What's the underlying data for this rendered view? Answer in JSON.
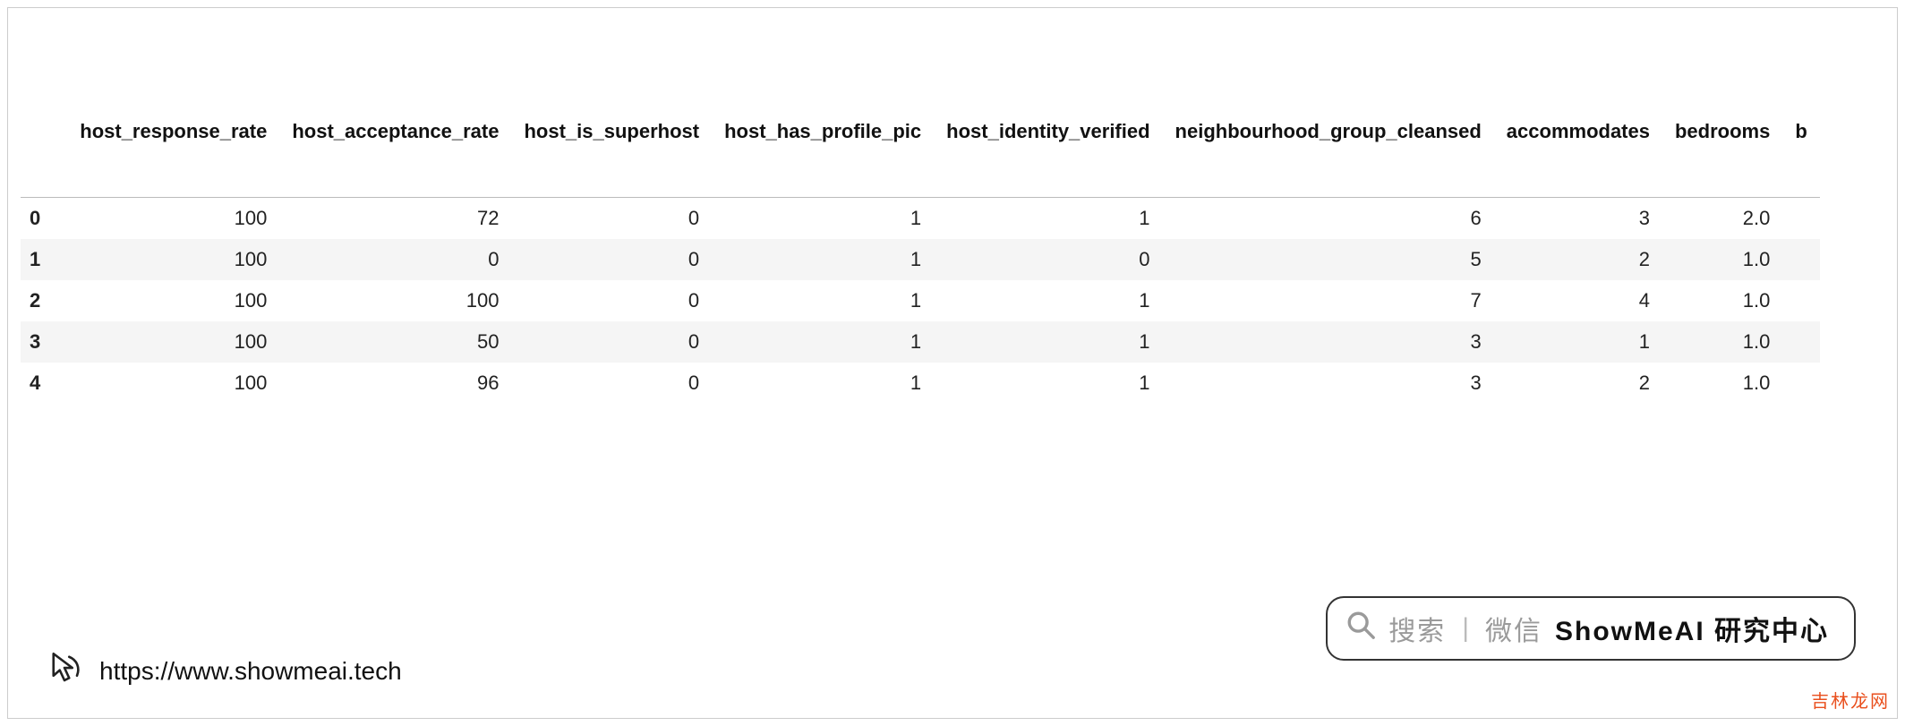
{
  "table": {
    "columns": [
      "host_response_rate",
      "host_acceptance_rate",
      "host_is_superhost",
      "host_has_profile_pic",
      "host_identity_verified",
      "neighbourhood_group_cleansed",
      "accommodates",
      "bedrooms",
      "b"
    ],
    "index": [
      "0",
      "1",
      "2",
      "3",
      "4"
    ],
    "rows": [
      [
        "100",
        "72",
        "0",
        "1",
        "1",
        "6",
        "3",
        "2.0",
        ""
      ],
      [
        "100",
        "0",
        "0",
        "1",
        "0",
        "5",
        "2",
        "1.0",
        ""
      ],
      [
        "100",
        "100",
        "0",
        "1",
        "1",
        "7",
        "4",
        "1.0",
        ""
      ],
      [
        "100",
        "50",
        "0",
        "1",
        "1",
        "3",
        "1",
        "1.0",
        ""
      ],
      [
        "100",
        "96",
        "0",
        "1",
        "1",
        "3",
        "2",
        "1.0",
        ""
      ]
    ]
  },
  "footer": {
    "url": "https://www.showmeai.tech"
  },
  "search_pill": {
    "grey": "搜索",
    "grey2": "微信",
    "bold": "ShowMeAI 研究中心"
  },
  "corner": "吉林龙网"
}
